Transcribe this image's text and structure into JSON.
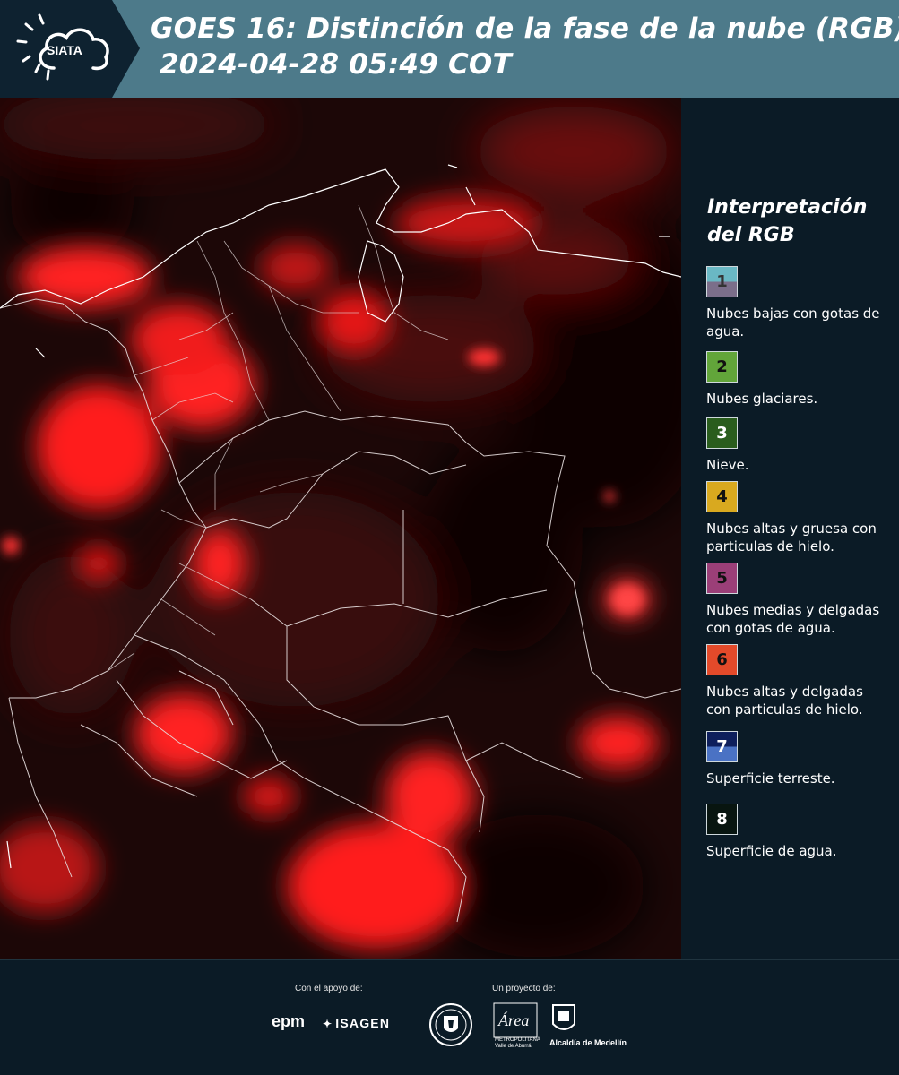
{
  "header": {
    "logo_text": "SIATA",
    "title_line1": "GOES 16: Distinción de la fase de la nube (RGB)",
    "title_line2": "2024-04-28 05:49 COT",
    "background": "#4d7a8a"
  },
  "legend": {
    "title_line1": "Interpretación",
    "title_line2": "del RGB",
    "items": [
      {
        "number": "1",
        "label": "Nubes bajas con gotas de agua.",
        "color_top": "#6ab8c4",
        "color_bottom": "#7b6e8a"
      },
      {
        "number": "2",
        "label": "Nubes glaciares.",
        "color_top": "#62a53a",
        "color_bottom": "#62a53a"
      },
      {
        "number": "3",
        "label": "Nieve.",
        "color_top": "#2a5d1d",
        "color_bottom": "#2a5d1d"
      },
      {
        "number": "4",
        "label": "Nubes altas y gruesa con particulas de hielo.",
        "color_top": "#d9a91f",
        "color_bottom": "#d9a91f"
      },
      {
        "number": "5",
        "label": "Nubes medias y delgadas con gotas de agua.",
        "color_top": "#9b3f78",
        "color_bottom": "#9b3f78"
      },
      {
        "number": "6",
        "label": "Nubes altas y delgadas con particulas de hielo.",
        "color_top": "#e34a2a",
        "color_bottom": "#e34a2a"
      },
      {
        "number": "7",
        "label": "Superficie terreste.",
        "color_top": "#0e1f5c",
        "color_bottom": "#4a72c4"
      },
      {
        "number": "8",
        "label": "Superficie de agua.",
        "color_top": "#081510",
        "color_bottom": "#081510"
      }
    ]
  },
  "footer": {
    "support_label": "Con el apoyo de:",
    "project_label": "Un proyecto de:",
    "epm": "epm",
    "isagen": "ISAGEN",
    "area_name": "Área",
    "area_sub1": "METROPOLITANA",
    "area_sub2": "Valle de Aburrá",
    "alcaldia": "Alcaldía de Medellín"
  }
}
